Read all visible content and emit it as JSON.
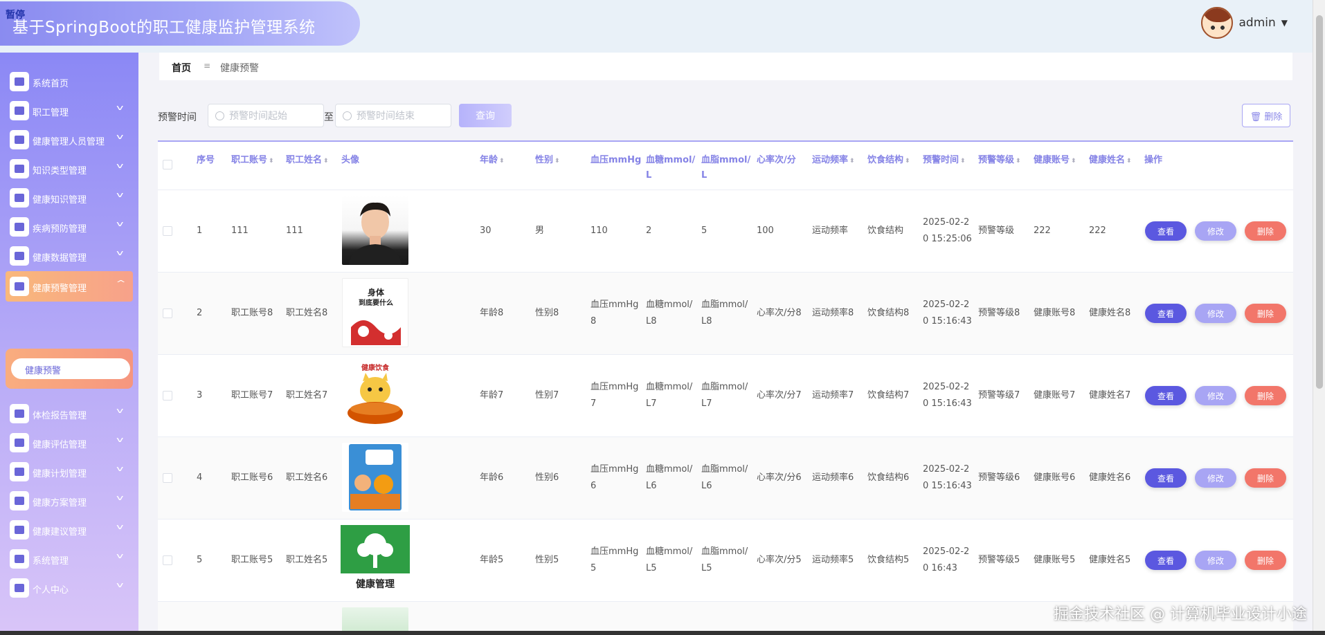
{
  "app": {
    "paused_label": "暂停",
    "title": "基于SpringBoot的职工健康监护管理系统"
  },
  "user": {
    "name": "admin"
  },
  "sidebar": {
    "items": [
      {
        "label": "系统首页",
        "icon": "home-icon",
        "has_children": false
      },
      {
        "label": "职工管理",
        "icon": "pin-icon",
        "has_children": true
      },
      {
        "label": "健康管理人员管理",
        "icon": "chart-icon",
        "has_children": true
      },
      {
        "label": "知识类型管理",
        "icon": "briefcase-icon",
        "has_children": true
      },
      {
        "label": "健康知识管理",
        "icon": "clipboard-check-icon",
        "has_children": true
      },
      {
        "label": "疾病预防管理",
        "icon": "grid-icon",
        "has_children": true
      },
      {
        "label": "健康数据管理",
        "icon": "ticket-icon",
        "has_children": true
      },
      {
        "label": "健康预警管理",
        "icon": "clipboard-icon",
        "has_children": true,
        "active": true
      },
      {
        "label": "体检报告管理",
        "icon": "monitor-icon",
        "has_children": true
      },
      {
        "label": "健康评估管理",
        "icon": "wallet-icon",
        "has_children": true
      },
      {
        "label": "健康计划管理",
        "icon": "user-icon",
        "has_children": true
      },
      {
        "label": "健康方案管理",
        "icon": "flag-icon",
        "has_children": true
      },
      {
        "label": "健康建议管理",
        "icon": "bulb-icon",
        "has_children": true
      },
      {
        "label": "系统管理",
        "icon": "grid-icon",
        "has_children": true
      },
      {
        "label": "个人中心",
        "icon": "person-icon",
        "has_children": true
      }
    ],
    "submenu": {
      "label": "健康预警"
    }
  },
  "breadcrumb": {
    "home": "首页",
    "separator": "≡",
    "current": "健康预警"
  },
  "filters": {
    "label": "预警时间",
    "start_placeholder": "预警时间起始",
    "end_placeholder": "预警时间结束",
    "to_label": "至",
    "query_label": "查询",
    "delete_label": "删除"
  },
  "table": {
    "headers": {
      "index": "序号",
      "emp_account": "职工账号",
      "emp_name": "职工姓名",
      "avatar": "头像",
      "age": "年龄",
      "gender": "性别",
      "bp": "血压mmHg",
      "glucose_1": "血糖mmol/",
      "glucose_2": "L",
      "lipid_1": "血脂mmol/",
      "lipid_2": "L",
      "heart": "心率次/分",
      "exercise": "运动频率",
      "diet": "饮食结构",
      "warn_time": "预警时间",
      "warn_level": "预警等级",
      "health_account": "健康账号",
      "health_name": "健康姓名",
      "actions": "操作"
    },
    "rows": [
      {
        "index": "1",
        "emp_account": "111",
        "emp_name": "111",
        "avatar": "portrait-photo",
        "age": "30",
        "gender": "男",
        "bp_1": "110",
        "bp_2": "",
        "glu_1": "2",
        "glu_2": "",
        "lip_1": "5",
        "lip_2": "",
        "heart": "100",
        "exercise": "运动频率",
        "diet": "饮食结构",
        "time_1": "2025-02-2",
        "time_2": "0 15:25:06",
        "level": "预警等级",
        "h_account": "222",
        "h_name": "222"
      },
      {
        "index": "2",
        "emp_account": "职工账号8",
        "emp_name": "职工姓名8",
        "avatar": "book-cover-red",
        "age": "年龄8",
        "gender": "性别8",
        "bp_1": "血压mmHg",
        "bp_2": "8",
        "glu_1": "血糖mmol/",
        "glu_2": "L8",
        "lip_1": "血脂mmol/",
        "lip_2": "L8",
        "heart": "心率次/分8",
        "exercise": "运动频率8",
        "diet": "饮食结构8",
        "time_1": "2025-02-2",
        "time_2": "0 15:16:43",
        "level": "预警等级8",
        "h_account": "健康账号8",
        "h_name": "健康姓名8"
      },
      {
        "index": "3",
        "emp_account": "职工账号7",
        "emp_name": "职工姓名7",
        "avatar": "hotpot-cartoon",
        "age": "年龄7",
        "gender": "性别7",
        "bp_1": "血压mmHg",
        "bp_2": "7",
        "glu_1": "血糖mmol/",
        "glu_2": "L7",
        "lip_1": "血脂mmol/",
        "lip_2": "L7",
        "heart": "心率次/分7",
        "exercise": "运动频率7",
        "diet": "饮食结构7",
        "time_1": "2025-02-2",
        "time_2": "0 15:16:43",
        "level": "预警等级7",
        "h_account": "健康账号7",
        "h_name": "健康姓名7"
      },
      {
        "index": "4",
        "emp_account": "职工账号6",
        "emp_name": "职工姓名6",
        "avatar": "kids-book-cover",
        "age": "年龄6",
        "gender": "性别6",
        "bp_1": "血压mmHg",
        "bp_2": "6",
        "glu_1": "血糖mmol/",
        "glu_2": "L6",
        "lip_1": "血脂mmol/",
        "lip_2": "L6",
        "heart": "心率次/分6",
        "exercise": "运动频率6",
        "diet": "饮食结构6",
        "time_1": "2025-02-2",
        "time_2": "0 15:16:43",
        "level": "预警等级6",
        "h_account": "健康账号6",
        "h_name": "健康姓名6"
      },
      {
        "index": "5",
        "emp_account": "职工账号5",
        "emp_name": "职工姓名5",
        "avatar": "tree-logo-green",
        "age": "年龄5",
        "gender": "性别5",
        "bp_1": "血压mmHg",
        "bp_2": "5",
        "glu_1": "血糖mmol/",
        "glu_2": "L5",
        "lip_1": "血脂mmol/",
        "lip_2": "L5",
        "heart": "心率次/分5",
        "exercise": "运动频率5",
        "diet": "饮食结构5",
        "time_1": "2025-02-2",
        "time_2": "0 16:43",
        "level": "预警等级5",
        "h_account": "健康账号5",
        "h_name": "健康姓名5"
      }
    ],
    "row_actions": {
      "view": "查看",
      "edit": "修改",
      "delete": "删除"
    },
    "images": {
      "book_title_1": "身体",
      "book_title_2": "到底要什么",
      "hotpot_caption": "健康饮食",
      "tree_caption": "健康管理"
    }
  },
  "watermark": "掘金技术社区 @ 计算机毕业设计小途",
  "colors": {
    "accent": "#8583e6",
    "view": "#5b58e0",
    "edit": "#a8a5f4",
    "delete": "#f2766a",
    "active_menu": "#f9b87b"
  }
}
